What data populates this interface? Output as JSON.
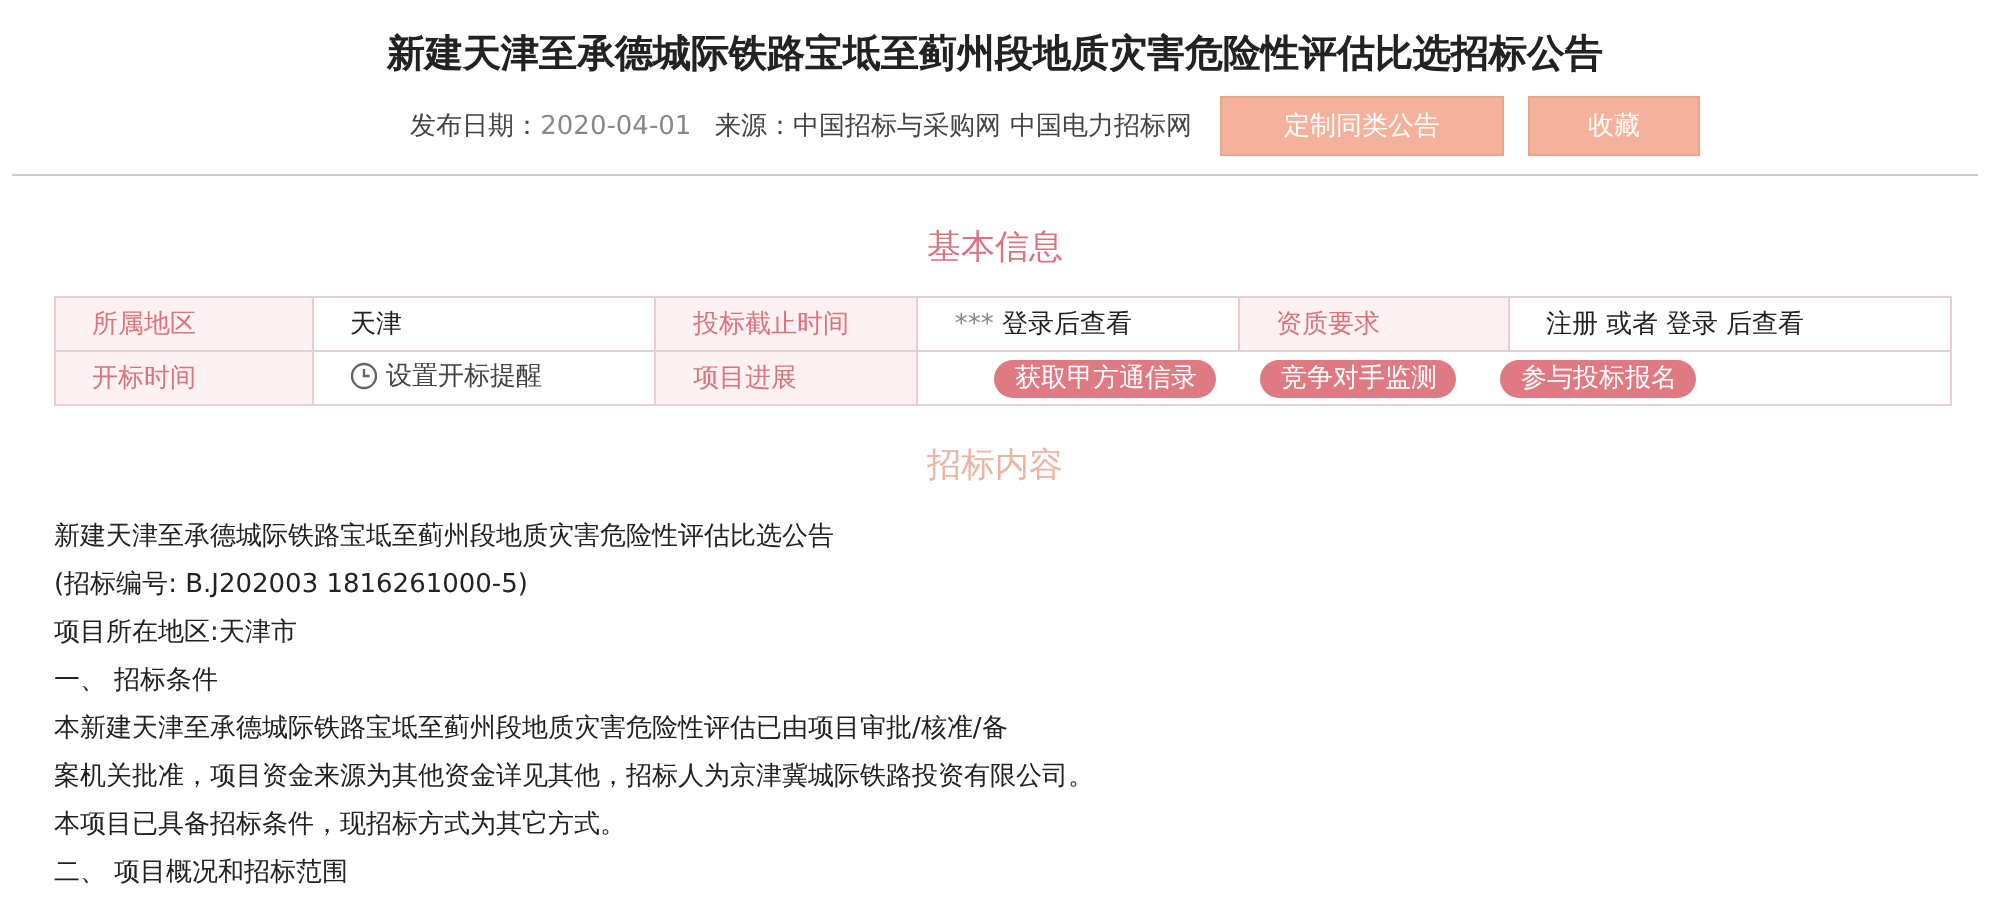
{
  "title": "新建天津至承德城际铁路宝坻至蓟州段地质灾害危险性评估比选招标公告",
  "meta": {
    "date_label": "发布日期：",
    "date": "2020-04-01",
    "source_label": "来源：",
    "sources": "中国招标与采购网 中国电力招标网"
  },
  "header_buttons": [
    "定制同类公告",
    "收藏"
  ],
  "basic_info": {
    "heading": "基本信息",
    "rows": [
      [
        {
          "kind": "label",
          "text": "所属地区"
        },
        {
          "kind": "value",
          "text": "天津"
        },
        {
          "kind": "label",
          "text": "投标截止时间"
        },
        {
          "kind": "masked",
          "mask": "***",
          "text": "登录后查看"
        },
        {
          "kind": "label",
          "text": "资质要求"
        },
        {
          "kind": "value",
          "text": "注册 或者 登录 后查看"
        }
      ],
      [
        {
          "kind": "label",
          "text": "开标时间"
        },
        {
          "kind": "reminder",
          "text": "设置开标提醒"
        },
        {
          "kind": "label",
          "text": "项目进展"
        },
        {
          "kind": "pills",
          "colspan": 3,
          "pills": [
            "获取甲方通信录",
            "竞争对手监测",
            "参与投标报名"
          ]
        }
      ]
    ]
  },
  "content": {
    "heading": "招标内容",
    "lines": [
      "新建天津至承德城际铁路宝坻至蓟州段地质灾害危险性评估比选公告",
      "(招标编号: B.J202003 1816261000-5)",
      "项目所在地区:天津市",
      "一、 招标条件",
      "本新建天津至承德城际铁路宝坻至蓟州段地质灾害危险性评估已由项目审批/核准/备",
      "案机关批准，项目资金来源为其他资金详见其他，招标人为京津冀城际铁路投资有限公司。",
      "本项目已具备招标条件，现招标方式为其它方式。",
      "二、 项目概况和招标范围"
    ]
  }
}
